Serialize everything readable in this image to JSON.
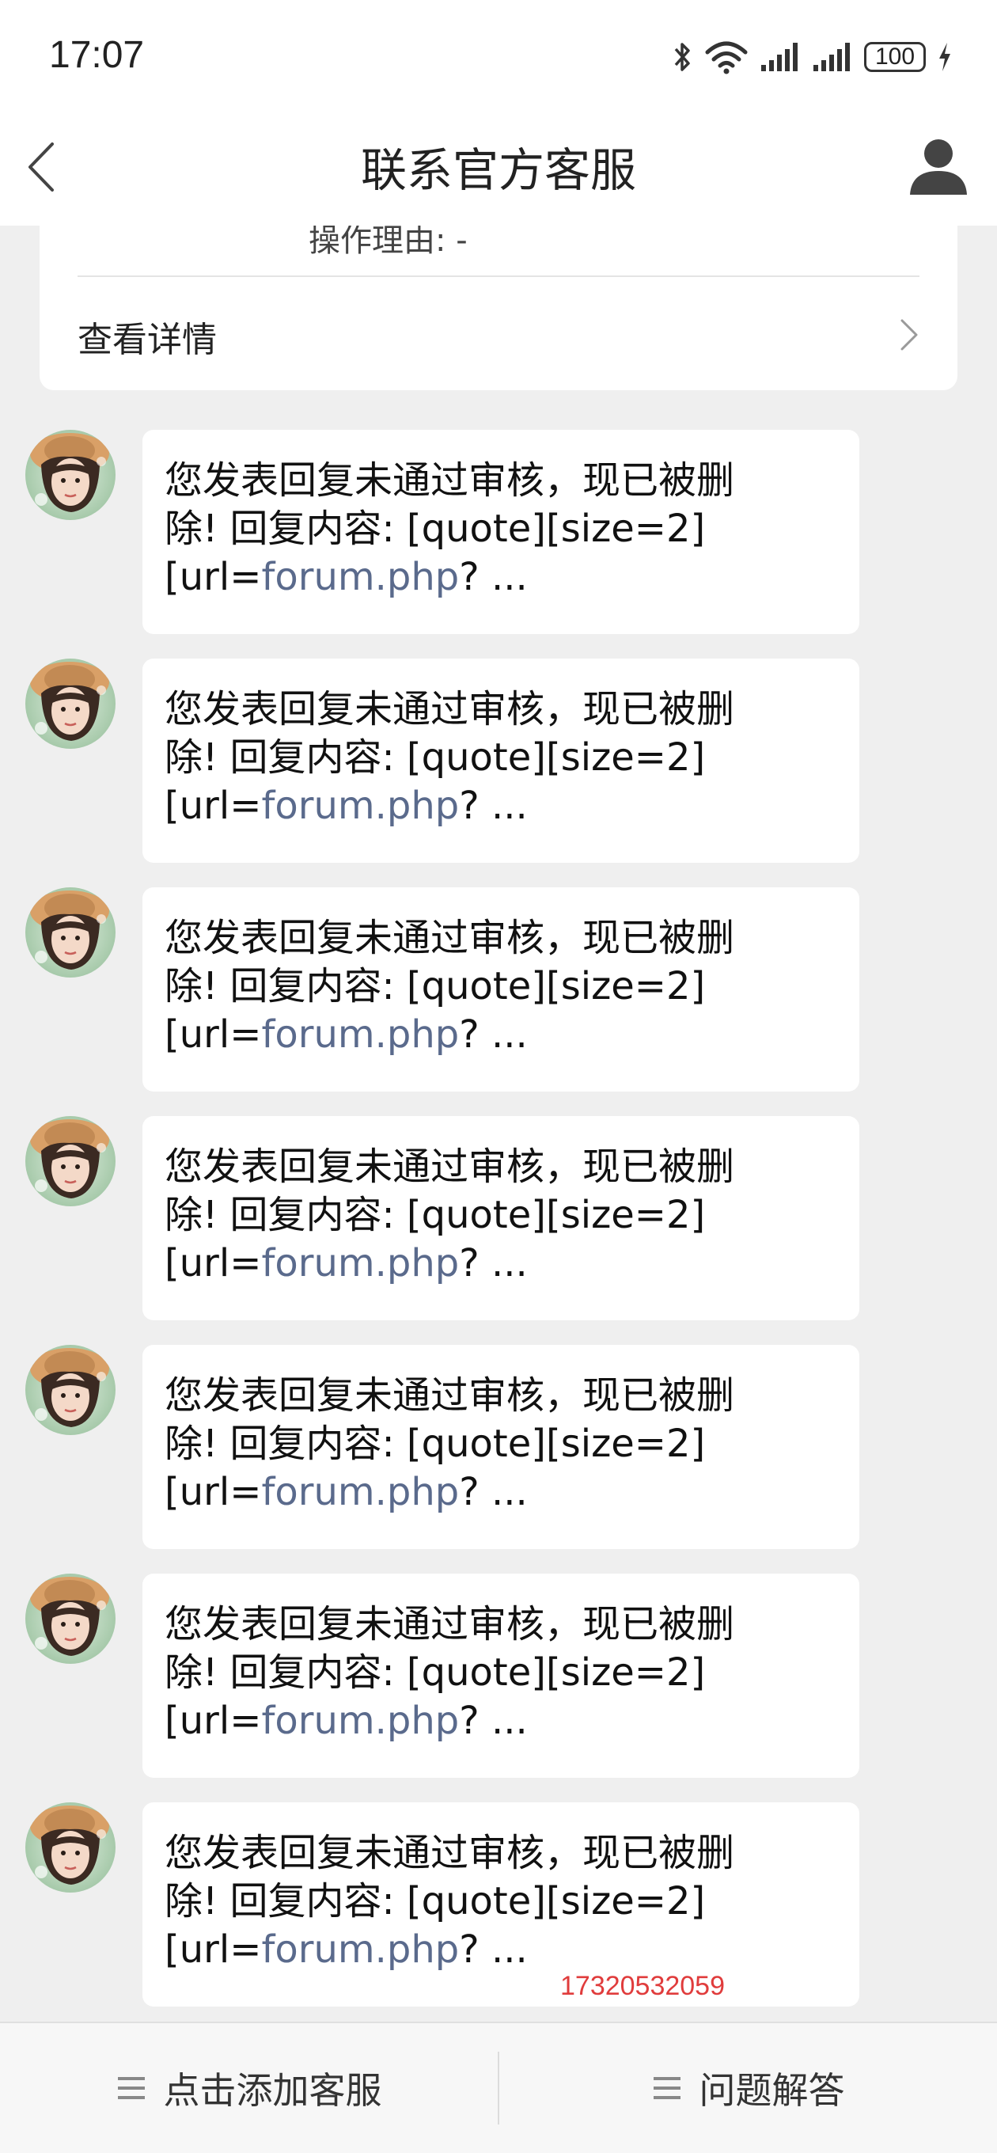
{
  "status_bar": {
    "time": "17:07",
    "battery": "100",
    "icons": [
      "bluetooth-icon",
      "wifi-icon",
      "signal-icon",
      "signal-icon",
      "battery-icon",
      "charging-icon"
    ]
  },
  "header": {
    "title": "联系官方客服",
    "back_icon": "chevron-left-icon",
    "user_icon": "user-icon"
  },
  "notice_card": {
    "partial_text": "操作理由: -",
    "details_label": "查看详情"
  },
  "messages": [
    {
      "line1": "您发表回复未通过审核，现已被删",
      "line2": "除!  回复内容: [quote][size=2]",
      "line3_prefix": "[url=",
      "line3_link": "forum.php",
      "line3_suffix": "? ..."
    },
    {
      "line1": "您发表回复未通过审核，现已被删",
      "line2": "除!  回复内容: [quote][size=2]",
      "line3_prefix": "[url=",
      "line3_link": "forum.php",
      "line3_suffix": "? ..."
    },
    {
      "line1": "您发表回复未通过审核，现已被删",
      "line2": "除!  回复内容: [quote][size=2]",
      "line3_prefix": "[url=",
      "line3_link": "forum.php",
      "line3_suffix": "? ..."
    },
    {
      "line1": "您发表回复未通过审核，现已被删",
      "line2": "除!  回复内容: [quote][size=2]",
      "line3_prefix": "[url=",
      "line3_link": "forum.php",
      "line3_suffix": "? ..."
    },
    {
      "line1": "您发表回复未通过审核，现已被删",
      "line2": "除!  回复内容: [quote][size=2]",
      "line3_prefix": "[url=",
      "line3_link": "forum.php",
      "line3_suffix": "? ..."
    },
    {
      "line1": "您发表回复未通过审核，现已被删",
      "line2": "除!  回复内容: [quote][size=2]",
      "line3_prefix": "[url=",
      "line3_link": "forum.php",
      "line3_suffix": "? ..."
    },
    {
      "line1": "您发表回复未通过审核，现已被删",
      "line2": "除!  回复内容: [quote][size=2]",
      "line3_prefix": "[url=",
      "line3_link": "forum.php",
      "line3_suffix": "? ..."
    }
  ],
  "watermark_phone": "17320532059",
  "bottom_bar": {
    "left_label": "点击添加客服",
    "right_label": "问题解答",
    "icon": "menu-icon"
  },
  "colors": {
    "background": "#efefef",
    "link": "#5a6a8c",
    "phone": "#e03c3c"
  }
}
